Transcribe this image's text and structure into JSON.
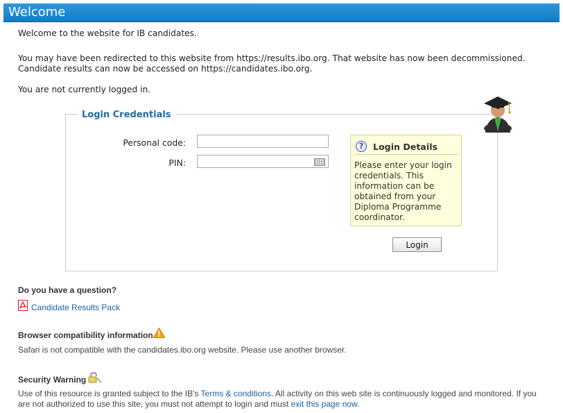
{
  "header": {
    "title": "Welcome"
  },
  "intro": {
    "welcome": "Welcome to the website for IB candidates.",
    "redirect_line1": "You may have been redirected to this website from https://results.ibo.org. That website has now been decommissioned.",
    "redirect_line2": "Candidate results can now be accessed on https://candidates.ibo.org.",
    "login_status": "You are not currently logged in."
  },
  "login": {
    "legend": "Login Credentials",
    "personal_code_label": "Personal code:",
    "pin_label": "PIN:",
    "personal_code_value": "",
    "pin_value": "",
    "button_label": "Login"
  },
  "help": {
    "title": "Login Details",
    "text": "Please enter your login credentials. This information can be obtained from your Diploma Programme coordinator."
  },
  "question": {
    "heading": "Do you have a question?",
    "link": "Candidate Results Pack"
  },
  "browser": {
    "heading": "Browser compatibility information",
    "text": "Safari is not compatible with the candidates.ibo.org website. Please use another browser."
  },
  "security": {
    "heading": "Security Warning",
    "text_before": "Use of this resource is granted subject to the IB's ",
    "terms_link": "Terms & conditions",
    "text_middle": ". All activity on this web site is continuously logged and monitored. If you are not authorized to use this site, you must not attempt to login and must ",
    "exit_link": "exit this page now",
    "text_after": "."
  }
}
